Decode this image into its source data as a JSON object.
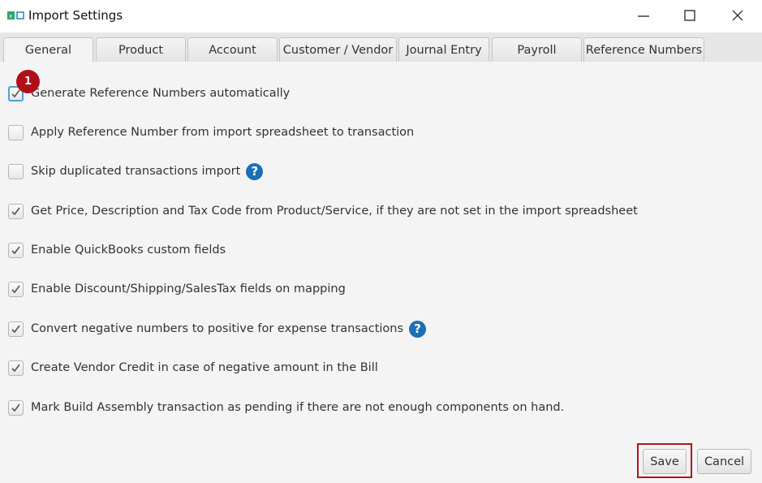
{
  "window": {
    "title": "Import Settings",
    "icon": "app-logo-icon",
    "controls": [
      "minimize-icon",
      "maximize-icon",
      "close-icon"
    ]
  },
  "tabs": [
    {
      "label": "General",
      "active": true
    },
    {
      "label": "Product",
      "active": false
    },
    {
      "label": "Account",
      "active": false
    },
    {
      "label": "Customer / Vendor",
      "active": false
    },
    {
      "label": "Journal Entry",
      "active": false
    },
    {
      "label": "Payroll",
      "active": false
    },
    {
      "label": "Reference Numbers",
      "active": false
    }
  ],
  "options": [
    {
      "label": "Generate Reference Numbers automatically",
      "checked": true,
      "help": false
    },
    {
      "label": "Apply Reference Number from import spreadsheet to transaction",
      "checked": false,
      "help": false
    },
    {
      "label": "Skip duplicated transactions import",
      "checked": false,
      "help": true
    },
    {
      "label": "Get Price, Description and Tax Code from Product/Service, if they are not set in the import spreadsheet",
      "checked": true,
      "help": false
    },
    {
      "label": "Enable QuickBooks custom fields",
      "checked": true,
      "help": false
    },
    {
      "label": "Enable Discount/Shipping/SalesTax fields on mapping",
      "checked": true,
      "help": false
    },
    {
      "label": "Convert negative numbers to positive for expense transactions",
      "checked": true,
      "help": true
    },
    {
      "label": "Create Vendor Credit in case of negative amount in the Bill",
      "checked": true,
      "help": false
    },
    {
      "label": "Mark Build Assembly transaction as pending if there are not enough components on hand.",
      "checked": true,
      "help": false
    }
  ],
  "help_glyph": "?",
  "step_badge": "1",
  "buttons": {
    "save": "Save",
    "cancel": "Cancel"
  },
  "colors": {
    "accent": "#1d6fb5",
    "badge": "#b10f18",
    "highlight": "#b3121b"
  }
}
